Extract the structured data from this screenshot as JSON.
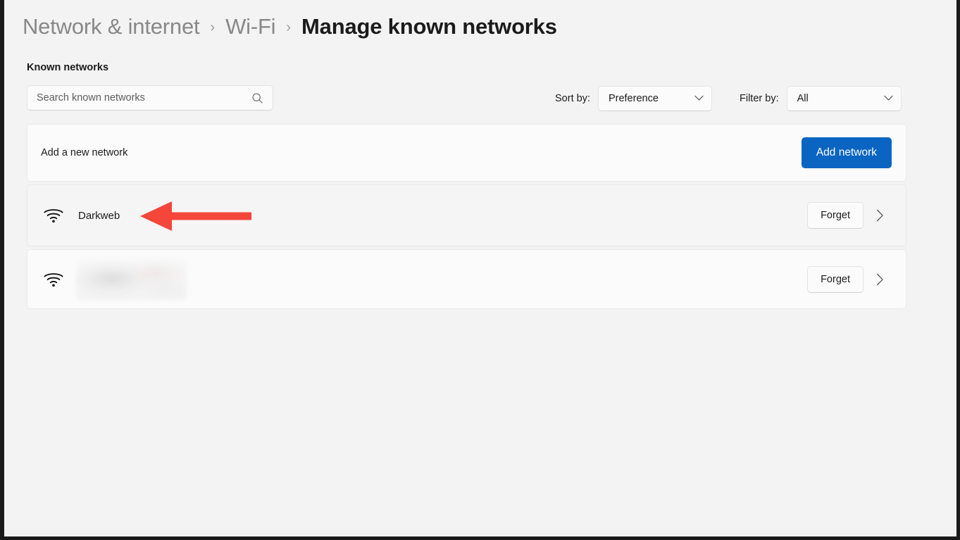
{
  "breadcrumb": {
    "items": [
      {
        "label": "Network & internet",
        "current": false
      },
      {
        "label": "Wi-Fi",
        "current": false
      },
      {
        "label": "Manage known networks",
        "current": true
      }
    ],
    "separator": "›"
  },
  "section": {
    "heading": "Known networks"
  },
  "search": {
    "placeholder": "Search known networks",
    "value": "",
    "icon": "search-icon"
  },
  "sort": {
    "label": "Sort by:",
    "value": "Preference",
    "icon": "chevron-down-icon"
  },
  "filter": {
    "label": "Filter by:",
    "value": "All",
    "icon": "chevron-down-icon"
  },
  "add_network": {
    "label": "Add a new network",
    "button_label": "Add network"
  },
  "networks": [
    {
      "name": "Darkweb",
      "redacted": false,
      "icon": "wifi-icon",
      "forget_label": "Forget",
      "chevron": "chevron-right-icon",
      "highlighted": true
    },
    {
      "name": "",
      "redacted": true,
      "icon": "wifi-icon",
      "forget_label": "Forget",
      "chevron": "chevron-right-icon",
      "highlighted": false
    }
  ],
  "annotation": {
    "type": "arrow-left",
    "color": "#f4463a",
    "points_to": "Darkweb"
  },
  "colors": {
    "accent": "#0a65c2",
    "page_background": "#f3f3f3",
    "card_background": "#fbfbfb",
    "card_background_highlight": "#f5f5f5",
    "text_primary": "#1b1b1b",
    "text_secondary": "#888888",
    "annotation_red": "#f4463a"
  }
}
